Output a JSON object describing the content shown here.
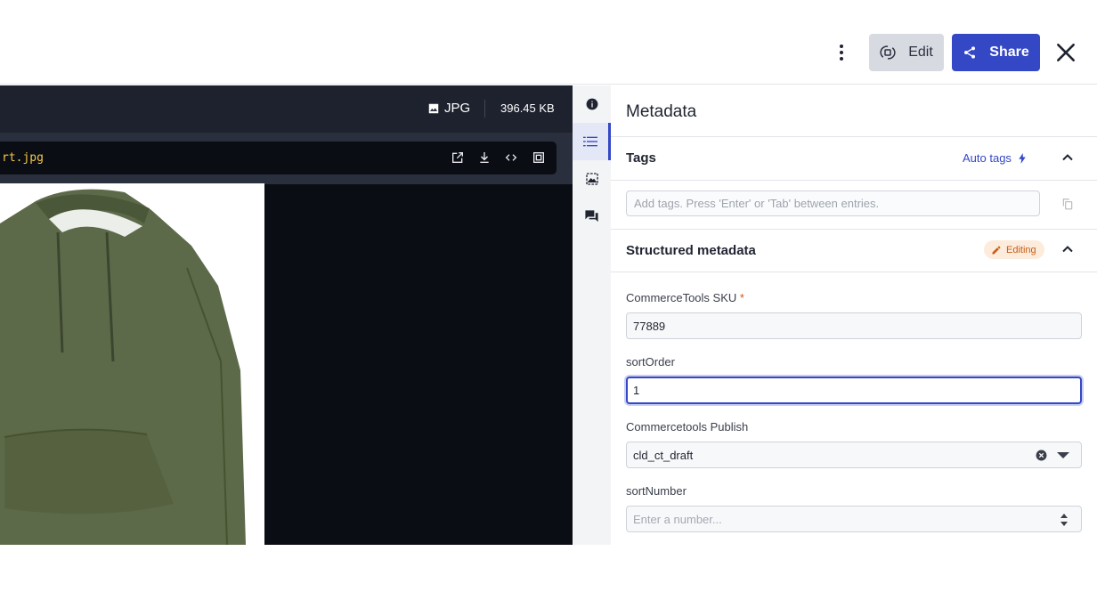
{
  "toolbar": {
    "more_icon": "more-vertical-icon",
    "edit_label": "Edit",
    "share_label": "Share",
    "close_icon": "close-icon"
  },
  "viewer": {
    "format": "JPG",
    "file_size": "396.45 KB",
    "url_text": "rt.jpg",
    "url_actions": [
      "open-external-icon",
      "download-icon",
      "embed-code-icon",
      "crop-icon"
    ]
  },
  "rail": {
    "items": [
      "info-icon",
      "metadata-icon",
      "derived-images-icon",
      "comments-icon"
    ],
    "active": "metadata-icon"
  },
  "metadata": {
    "title": "Metadata",
    "tags": {
      "title": "Tags",
      "auto_tags_label": "Auto tags",
      "placeholder": "Add tags. Press 'Enter' or 'Tab' between entries."
    },
    "structured": {
      "title": "Structured metadata",
      "badge": "Editing",
      "fields": {
        "sku_label": "CommerceTools SKU",
        "sku_required": "*",
        "sku_value": "77889",
        "sortorder_label": "sortOrder",
        "sortorder_value": "1",
        "publish_label": "Commercetools Publish",
        "publish_value": "cld_ct_draft",
        "sortnumber_label": "sortNumber",
        "sortnumber_placeholder": "Enter a number..."
      }
    }
  },
  "colors": {
    "accent": "#3447c5",
    "url_text": "#f2c94c",
    "editing_badge": "#c75e16",
    "hoodie": "#5d6a4a"
  }
}
